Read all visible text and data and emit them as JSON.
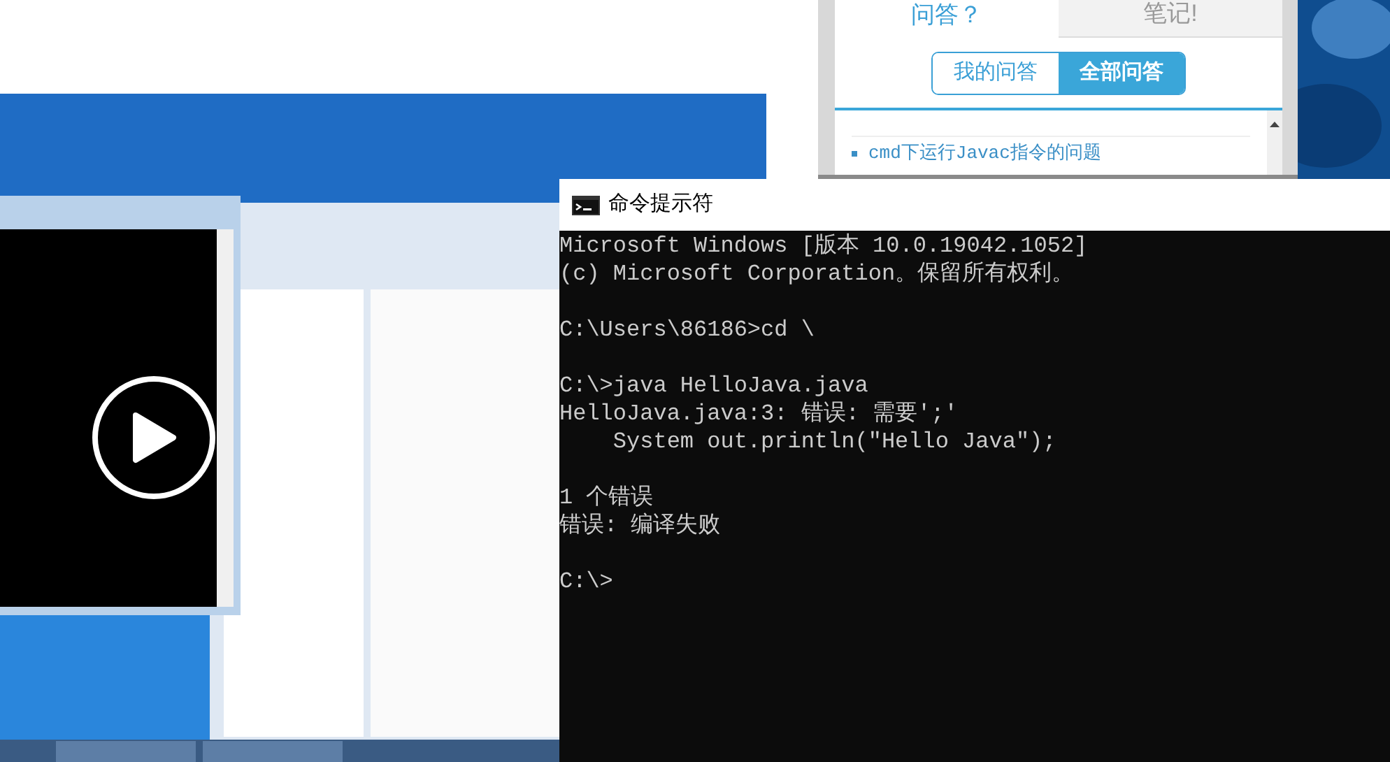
{
  "qa_panel": {
    "tabs": [
      {
        "label": "问答？",
        "selected": true
      },
      {
        "label": "笔记!",
        "selected": false
      }
    ],
    "filters": [
      {
        "label": "我的问答",
        "selected": false
      },
      {
        "label": "全部问答",
        "selected": true
      }
    ],
    "questions": [
      {
        "title": "cmd下运行Javac指令的问题"
      }
    ]
  },
  "cmd_window": {
    "title": "命令提示符",
    "blocks": [
      {
        "lines": [
          "Microsoft Windows [版本 10.0.19042.1052]",
          "(c) Microsoft Corporation。保留所有权利。"
        ]
      },
      {
        "lines": [
          "C:\\Users\\86186>cd \\"
        ]
      },
      {
        "lines": [
          "C:\\>java HelloJava.java",
          "HelloJava.java:3: 错误: 需要';'",
          "    System out.println(\"Hello Java\");"
        ]
      },
      {
        "lines": [
          "1 个错误",
          "错误: 编译失败"
        ]
      },
      {
        "lines": [
          "C:\\>"
        ]
      }
    ]
  }
}
